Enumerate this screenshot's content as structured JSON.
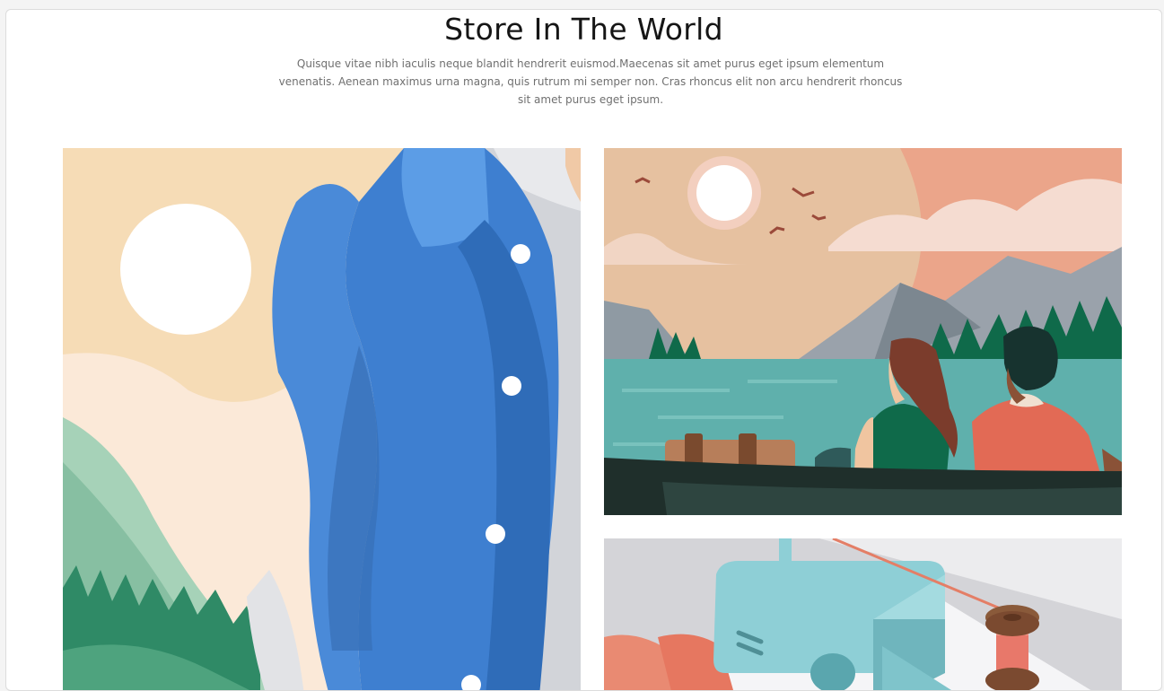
{
  "section": {
    "title": "Store In The World",
    "description": "Quisque vitae nibh iaculis neque blandit hendrerit euismod.Maecenas sit amet purus eget ipsum elementum venenatis. Aenean maximus urna magna, quis rutrum mi semper non. Cras rhoncus elit non arcu hendrerit rhoncus sit amet purus eget ipsum."
  },
  "gallery": {
    "images": [
      {
        "subject": "blue-shirt-illustration"
      },
      {
        "subject": "couple-in-boat-illustration"
      },
      {
        "subject": "sewing-machine-illustration"
      }
    ]
  },
  "colors": {
    "title": "#151515",
    "description": "#707070",
    "shirt_blue": "#4a8ad8",
    "sky_peach": "#f5dcb8",
    "lake_teal": "#5fb0ac",
    "sewing_teal": "#8ecfd6"
  }
}
